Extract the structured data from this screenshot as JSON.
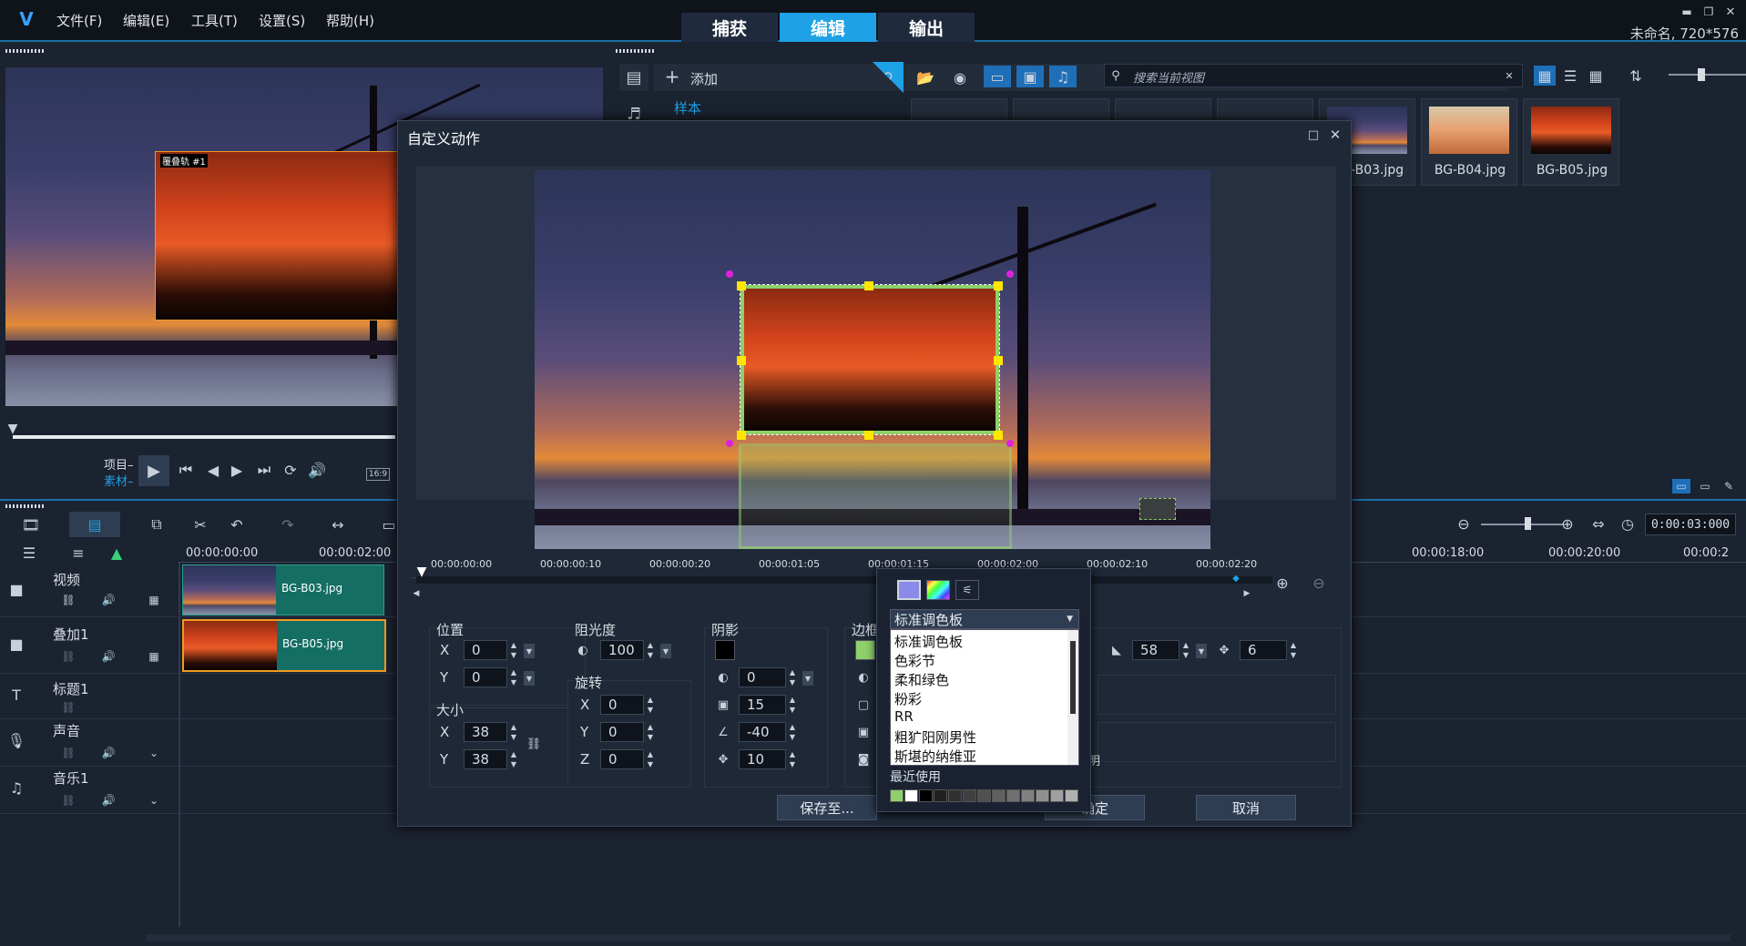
{
  "app": {
    "menu": [
      "文件(F)",
      "编辑(E)",
      "工具(T)",
      "设置(S)",
      "帮助(H)"
    ],
    "modes": [
      "捕获",
      "编辑",
      "输出"
    ],
    "project_info": "未命名, 720*576"
  },
  "preview": {
    "overlay_label": "覆叠轨 #1",
    "project_label": "项目–",
    "clip_label": "素材–",
    "aspect": "16:9"
  },
  "library": {
    "add_label": "添加",
    "folder_label": "样本",
    "search_placeholder": "搜索当前视图",
    "thumbs": [
      "BG-B03.jpg",
      "BG-B04.jpg",
      "BG-B05.jpg"
    ]
  },
  "timeline": {
    "ruler": [
      "00:00:00:00",
      "00:00:02:00",
      "00:00:18:00",
      "00:00:20:00",
      "00:00:2"
    ],
    "timecode": "0:00:03:000",
    "tracks": [
      {
        "name": "视频",
        "clip": "BG-B03.jpg"
      },
      {
        "name": "叠加1",
        "clip": "BG-B05.jpg"
      },
      {
        "name": "标题1"
      },
      {
        "name": "声音"
      },
      {
        "name": "音乐1"
      }
    ]
  },
  "dialog": {
    "title": "自定义动作",
    "ruler": [
      "00:00:00:00",
      "00:00:00:10",
      "00:00:00:20",
      "00:00:01:05",
      "00:00:01:15",
      "00:00:02:00",
      "00:00:02:10",
      "00:00:02:20"
    ],
    "position": {
      "label": "位置",
      "x": "0",
      "y": "0"
    },
    "size": {
      "label": "大小",
      "x": "38",
      "y": "38"
    },
    "opacity": {
      "label": "阻光度",
      "value": "100"
    },
    "rotation": {
      "label": "旋转",
      "x": "0",
      "y": "0",
      "z": "0"
    },
    "shadow": {
      "label": "阴影",
      "v1": "0",
      "v2": "15",
      "v3": "-40",
      "v4": "10"
    },
    "border": {
      "label": "边框",
      "v1": "58",
      "v2": "6"
    },
    "save_label": "保存至...",
    "ok_label": "确定",
    "cancel_label": "取消"
  },
  "palette": {
    "selected": "标准调色板",
    "options": [
      "标准调色板",
      "色彩节",
      "柔和绿色",
      "粉彩",
      "RR",
      "粗犷阳刚男性",
      "斯堪的纳维亚"
    ],
    "recent_label": "最近使用",
    "recent_colors": [
      "#8fd06a",
      "#ffffff",
      "#000000",
      "#202020",
      "#303030",
      "#404040",
      "#505050",
      "#606060",
      "#707070",
      "#808080",
      "#909090",
      "#a0a0a0",
      "#b0b0b0"
    ]
  },
  "colors": {
    "accent": "#1ea1e6",
    "clip": "#156e63",
    "handle": "#ffe600",
    "border_green": "#8fd06a"
  }
}
